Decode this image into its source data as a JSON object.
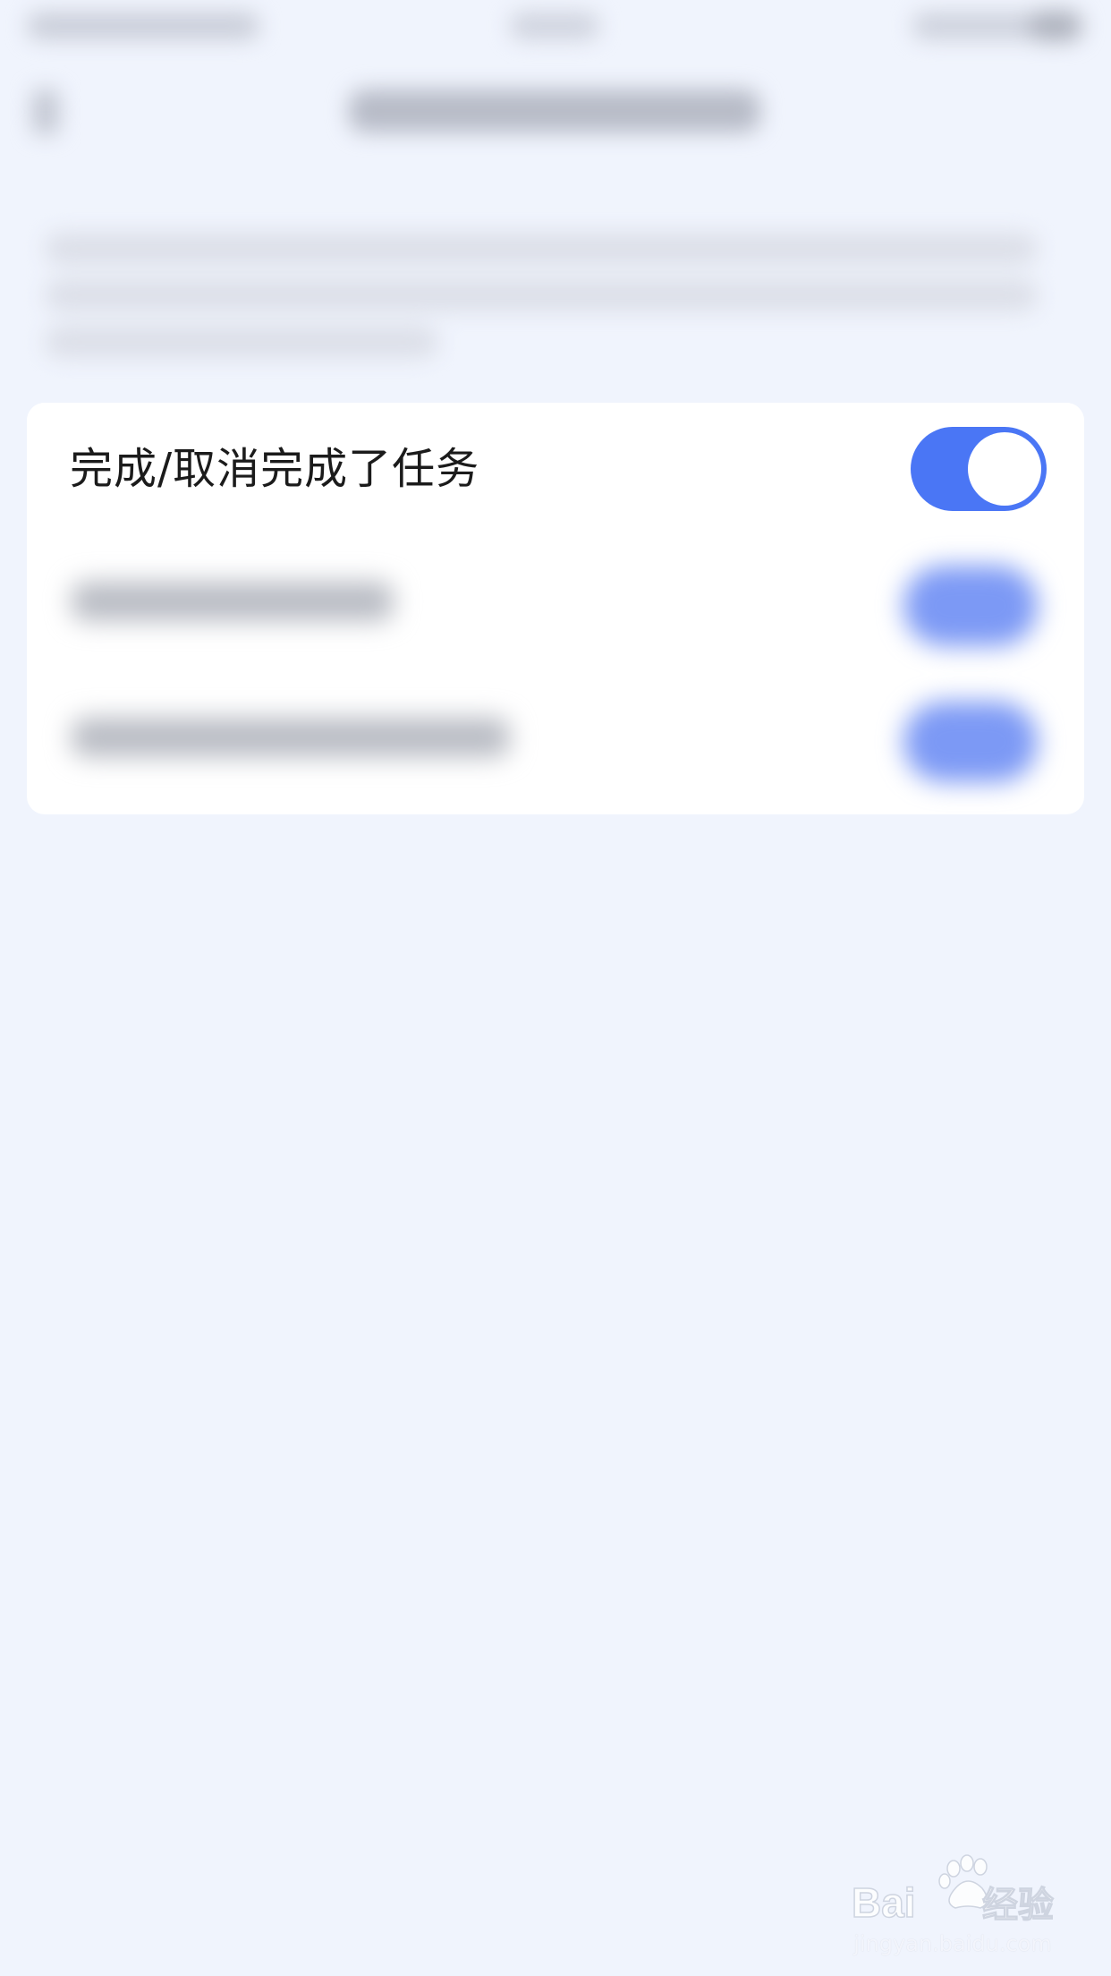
{
  "setting_rows": [
    {
      "label": "完成/取消完成了任务",
      "enabled": true
    }
  ],
  "colors": {
    "background": "#f0f4fd",
    "card": "#ffffff",
    "toggle_on": "#4a76f5",
    "text": "#1b1b1b"
  },
  "watermark": {
    "logo_text": "Baidu经验",
    "url": "jingyan.baidu.com"
  }
}
